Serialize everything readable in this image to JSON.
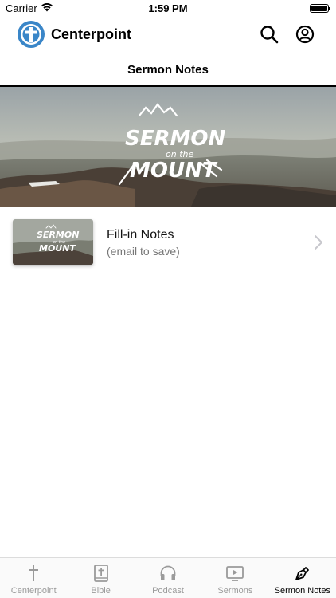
{
  "status_bar": {
    "carrier": "Carrier",
    "time": "1:59 PM"
  },
  "header": {
    "app_name": "Centerpoint",
    "brand_color": "#3a86c8"
  },
  "page": {
    "title": "Sermon Notes"
  },
  "hero": {
    "artwork_text": [
      "SERMON",
      "on the",
      "MOUNT"
    ]
  },
  "notes": [
    {
      "title": "Fill-in Notes",
      "subtitle": "(email to save)"
    }
  ],
  "tabs": [
    {
      "label": "Centerpoint",
      "icon": "cross-icon",
      "active": false
    },
    {
      "label": "Bible",
      "icon": "bible-icon",
      "active": false
    },
    {
      "label": "Podcast",
      "icon": "headphones-icon",
      "active": false
    },
    {
      "label": "Sermons",
      "icon": "tv-play-icon",
      "active": false
    },
    {
      "label": "Sermon Notes",
      "icon": "pen-nib-icon",
      "active": true
    }
  ],
  "colors": {
    "active_tab": "#000000",
    "inactive_tab": "#9a9a9a"
  }
}
